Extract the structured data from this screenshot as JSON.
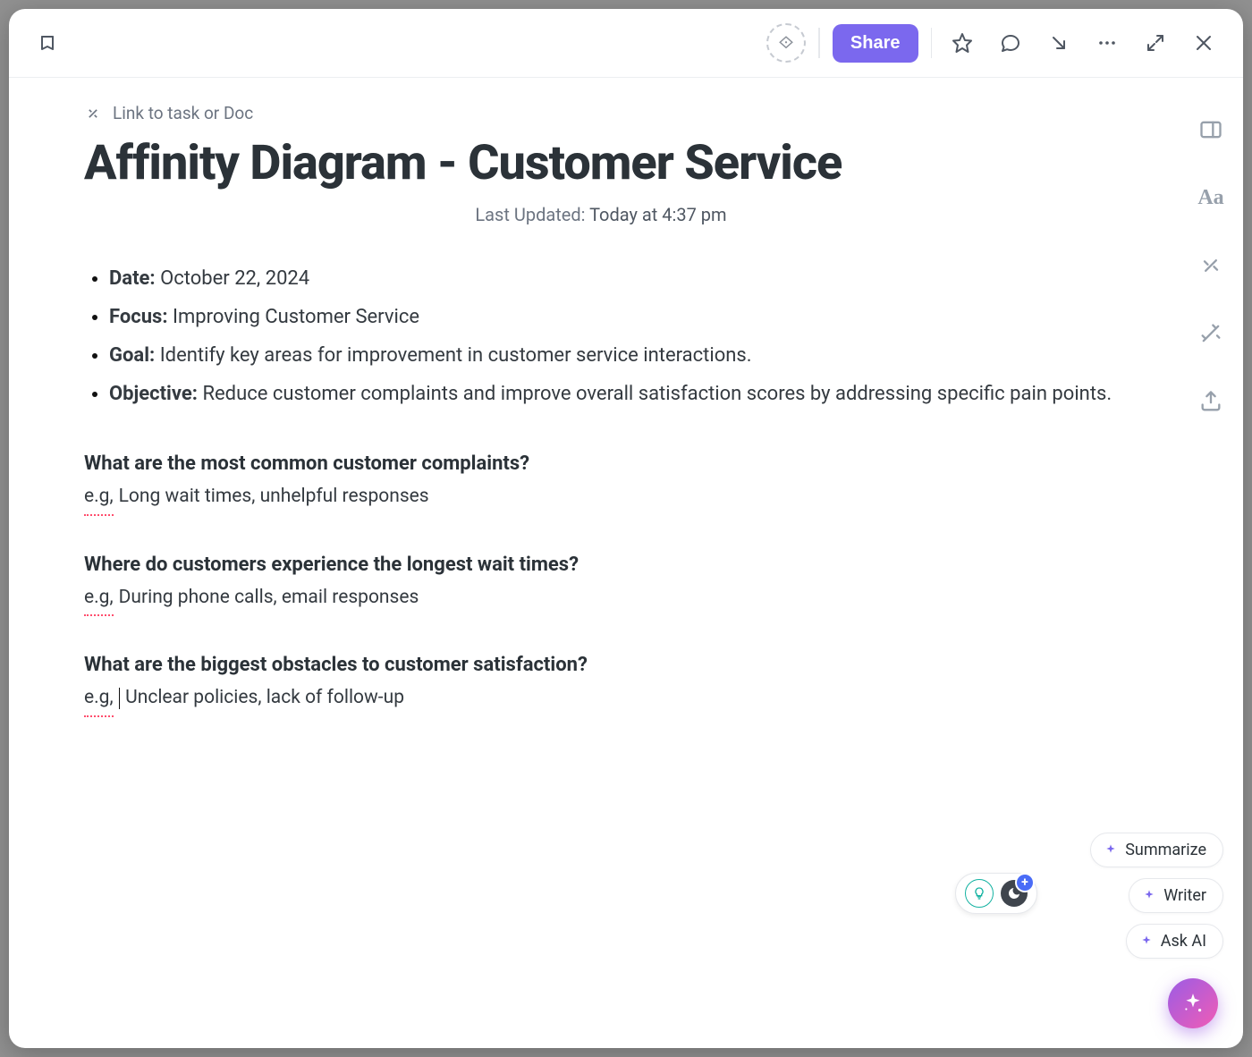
{
  "header": {
    "link_task_label": "Link to task or Doc",
    "share_label": "Share"
  },
  "doc": {
    "title": "Affinity Diagram - Customer Service",
    "last_updated_label": "Last Updated:",
    "last_updated_value": "Today at 4:37 pm",
    "meta": [
      {
        "label": "Date:",
        "value": "October 22, 2024"
      },
      {
        "label": "Focus:",
        "value": "Improving Customer Service"
      },
      {
        "label": "Goal:",
        "value": "Identify key areas for improvement in customer service interactions."
      },
      {
        "label": "Objective:",
        "value": "Reduce customer complaints and improve overall satisfaction scores by ad­dressing specific pain points."
      }
    ],
    "sections": [
      {
        "heading": "What are the most common customer complaints?",
        "eg_prefix": "e.g,",
        "eg_text": "Long wait times, unhelpful responses"
      },
      {
        "heading": "Where do customers experience the longest wait times?",
        "eg_prefix": "e.g,",
        "eg_text": "During phone calls, email responses"
      },
      {
        "heading": "What are the biggest obstacles to customer satisfaction?",
        "eg_prefix": "e.g,",
        "eg_text": "Unclear policies, lack of follow-up"
      }
    ]
  },
  "ai": {
    "chips": [
      "Summarize",
      "Writer",
      "Ask AI"
    ]
  },
  "icons": {
    "back": "back-icon",
    "tag": "tag-icon",
    "star": "star-icon",
    "comment": "comment-icon",
    "download": "download-icon",
    "more": "more-icon",
    "expand": "expand-icon",
    "close": "close-icon",
    "panel": "panel-icon",
    "font": "Aa",
    "relationship": "relationship-icon",
    "wand": "wand-icon",
    "export": "export-icon"
  }
}
